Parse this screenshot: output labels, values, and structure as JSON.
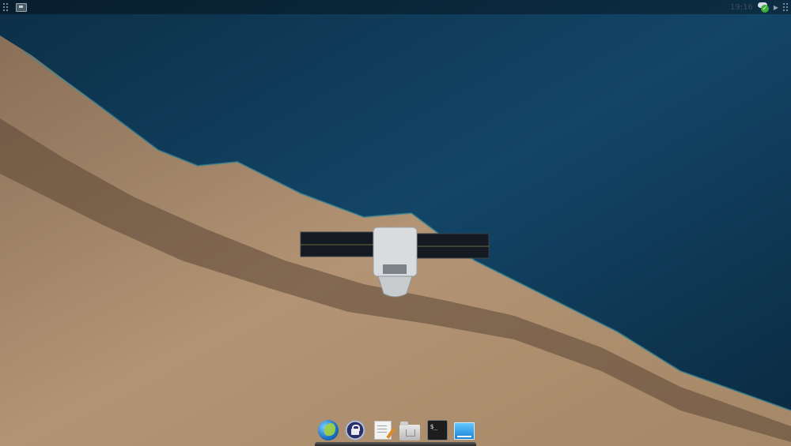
{
  "top_panel": {
    "clock": "19:16",
    "left_icons": [
      "grip-handle-icon",
      "show-desktop-icon"
    ],
    "right_icons": [
      "updater-ok-icon",
      "tray-expand-icon",
      "grip-handle-icon"
    ]
  },
  "dock": {
    "apps": [
      {
        "name": "web-browser-icon"
      },
      {
        "name": "lock-screen-icon"
      },
      {
        "name": "text-editor-icon"
      },
      {
        "name": "file-manager-icon"
      },
      {
        "name": "terminal-icon",
        "glyph": "$_"
      },
      {
        "name": "show-desktop-icon"
      }
    ]
  },
  "wallpaper": {
    "colors": {
      "ocean": "#0f3a57",
      "land": "#a98b6c",
      "shadow": "#4d3a2c"
    }
  }
}
